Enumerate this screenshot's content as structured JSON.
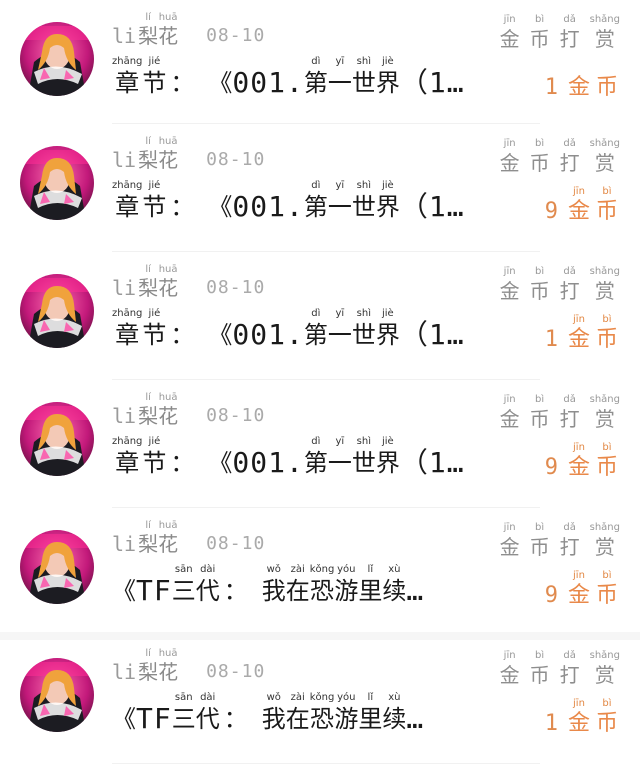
{
  "comments": [
    {
      "name_prefix": "li",
      "name_chars": [
        {
          "py": "lí",
          "hz": "梨"
        },
        {
          "py": "huā",
          "hz": "花"
        }
      ],
      "date": "08-10",
      "title_prefix": [
        {
          "py": "zhāng",
          "hz": "章"
        },
        {
          "py": "jié",
          "hz": "节"
        }
      ],
      "title_colon": "：",
      "title_open": "《",
      "title_latin": "001.",
      "title_chars": [
        {
          "py": "dì",
          "hz": "第"
        },
        {
          "py": "yī",
          "hz": "一"
        },
        {
          "py": "shì",
          "hz": "世"
        },
        {
          "py": "jiè",
          "hz": "界"
        }
      ],
      "title_tail": "（1…",
      "tip_label": [
        {
          "py": "jīn",
          "hz": "金"
        },
        {
          "py": "bì",
          "hz": "币"
        },
        {
          "py": "dǎ",
          "hz": "打"
        },
        {
          "py": "shǎng",
          "hz": "赏"
        }
      ],
      "amount": "1",
      "amount_unit": [
        {
          "py": "",
          "hz": "金"
        },
        {
          "py": "",
          "hz": "币"
        }
      ]
    },
    {
      "name_prefix": "li",
      "name_chars": [
        {
          "py": "lí",
          "hz": "梨"
        },
        {
          "py": "huā",
          "hz": "花"
        }
      ],
      "date": "08-10",
      "title_prefix": [
        {
          "py": "zhāng",
          "hz": "章"
        },
        {
          "py": "jié",
          "hz": "节"
        }
      ],
      "title_colon": "：",
      "title_open": "《",
      "title_latin": "001.",
      "title_chars": [
        {
          "py": "dì",
          "hz": "第"
        },
        {
          "py": "yī",
          "hz": "一"
        },
        {
          "py": "shì",
          "hz": "世"
        },
        {
          "py": "jiè",
          "hz": "界"
        }
      ],
      "title_tail": "（1…",
      "tip_label": [
        {
          "py": "jīn",
          "hz": "金"
        },
        {
          "py": "bì",
          "hz": "币"
        },
        {
          "py": "dǎ",
          "hz": "打"
        },
        {
          "py": "shǎng",
          "hz": "赏"
        }
      ],
      "amount": "9",
      "amount_unit": [
        {
          "py": "jīn",
          "hz": "金"
        },
        {
          "py": "bì",
          "hz": "币"
        }
      ]
    },
    {
      "name_prefix": "li",
      "name_chars": [
        {
          "py": "lí",
          "hz": "梨"
        },
        {
          "py": "huā",
          "hz": "花"
        }
      ],
      "date": "08-10",
      "title_prefix": [
        {
          "py": "zhāng",
          "hz": "章"
        },
        {
          "py": "jié",
          "hz": "节"
        }
      ],
      "title_colon": "：",
      "title_open": "《",
      "title_latin": "001.",
      "title_chars": [
        {
          "py": "dì",
          "hz": "第"
        },
        {
          "py": "yī",
          "hz": "一"
        },
        {
          "py": "shì",
          "hz": "世"
        },
        {
          "py": "jiè",
          "hz": "界"
        }
      ],
      "title_tail": "（1…",
      "tip_label": [
        {
          "py": "jīn",
          "hz": "金"
        },
        {
          "py": "bì",
          "hz": "币"
        },
        {
          "py": "dǎ",
          "hz": "打"
        },
        {
          "py": "shǎng",
          "hz": "赏"
        }
      ],
      "amount": "1",
      "amount_unit": [
        {
          "py": "jīn",
          "hz": "金"
        },
        {
          "py": "bì",
          "hz": "币"
        }
      ]
    },
    {
      "name_prefix": "li",
      "name_chars": [
        {
          "py": "lí",
          "hz": "梨"
        },
        {
          "py": "huā",
          "hz": "花"
        }
      ],
      "date": "08-10",
      "title_prefix": [
        {
          "py": "zhāng",
          "hz": "章"
        },
        {
          "py": "jié",
          "hz": "节"
        }
      ],
      "title_colon": "：",
      "title_open": "《",
      "title_latin": "001.",
      "title_chars": [
        {
          "py": "dì",
          "hz": "第"
        },
        {
          "py": "yī",
          "hz": "一"
        },
        {
          "py": "shì",
          "hz": "世"
        },
        {
          "py": "jiè",
          "hz": "界"
        }
      ],
      "title_tail": "（1…",
      "tip_label": [
        {
          "py": "jīn",
          "hz": "金"
        },
        {
          "py": "bì",
          "hz": "币"
        },
        {
          "py": "dǎ",
          "hz": "打"
        },
        {
          "py": "shǎng",
          "hz": "赏"
        }
      ],
      "amount": "9",
      "amount_unit": [
        {
          "py": "jīn",
          "hz": "金"
        },
        {
          "py": "bì",
          "hz": "币"
        }
      ]
    },
    {
      "name_prefix": "li",
      "name_chars": [
        {
          "py": "lí",
          "hz": "梨"
        },
        {
          "py": "huā",
          "hz": "花"
        }
      ],
      "date": "08-10",
      "title_prefix": [],
      "title_colon": "：",
      "title_open": "《",
      "title_latin": "TF",
      "title_chars": [
        {
          "py": "sān",
          "hz": "三"
        },
        {
          "py": "dài",
          "hz": "代"
        }
      ],
      "title_colon_after": true,
      "title_chars2": [
        {
          "py": "wǒ",
          "hz": "我"
        },
        {
          "py": "zài",
          "hz": "在"
        },
        {
          "py": "kǒng",
          "hz": "恐"
        },
        {
          "py": "yóu",
          "hz": "游"
        },
        {
          "py": "lǐ",
          "hz": "里"
        },
        {
          "py": "xù",
          "hz": "续"
        }
      ],
      "title_tail": "…",
      "tip_label": [
        {
          "py": "jīn",
          "hz": "金"
        },
        {
          "py": "bì",
          "hz": "币"
        },
        {
          "py": "dǎ",
          "hz": "打"
        },
        {
          "py": "shǎng",
          "hz": "赏"
        }
      ],
      "amount": "9",
      "amount_unit": [
        {
          "py": "jīn",
          "hz": "金"
        },
        {
          "py": "bì",
          "hz": "币"
        }
      ]
    },
    {
      "name_prefix": "li",
      "name_chars": [
        {
          "py": "lí",
          "hz": "梨"
        },
        {
          "py": "huā",
          "hz": "花"
        }
      ],
      "date": "08-10",
      "title_prefix": [],
      "title_colon": "：",
      "title_open": "《",
      "title_latin": "TF",
      "title_chars": [
        {
          "py": "sān",
          "hz": "三"
        },
        {
          "py": "dài",
          "hz": "代"
        }
      ],
      "title_colon_after": true,
      "title_chars2": [
        {
          "py": "wǒ",
          "hz": "我"
        },
        {
          "py": "zài",
          "hz": "在"
        },
        {
          "py": "kǒng",
          "hz": "恐"
        },
        {
          "py": "yóu",
          "hz": "游"
        },
        {
          "py": "lǐ",
          "hz": "里"
        },
        {
          "py": "xù",
          "hz": "续"
        }
      ],
      "title_tail": "…",
      "tip_label": [
        {
          "py": "jīn",
          "hz": "金"
        },
        {
          "py": "bì",
          "hz": "币"
        },
        {
          "py": "dǎ",
          "hz": "打"
        },
        {
          "py": "shǎng",
          "hz": "赏"
        }
      ],
      "amount": "1",
      "amount_unit": [
        {
          "py": "jīn",
          "hz": "金"
        },
        {
          "py": "bì",
          "hz": "币"
        }
      ]
    }
  ],
  "colors": {
    "accent": "#e9894a",
    "muted": "#8e8e8e",
    "text": "#1a1a1a"
  },
  "icons": {
    "avatar": "user-avatar-photo"
  }
}
